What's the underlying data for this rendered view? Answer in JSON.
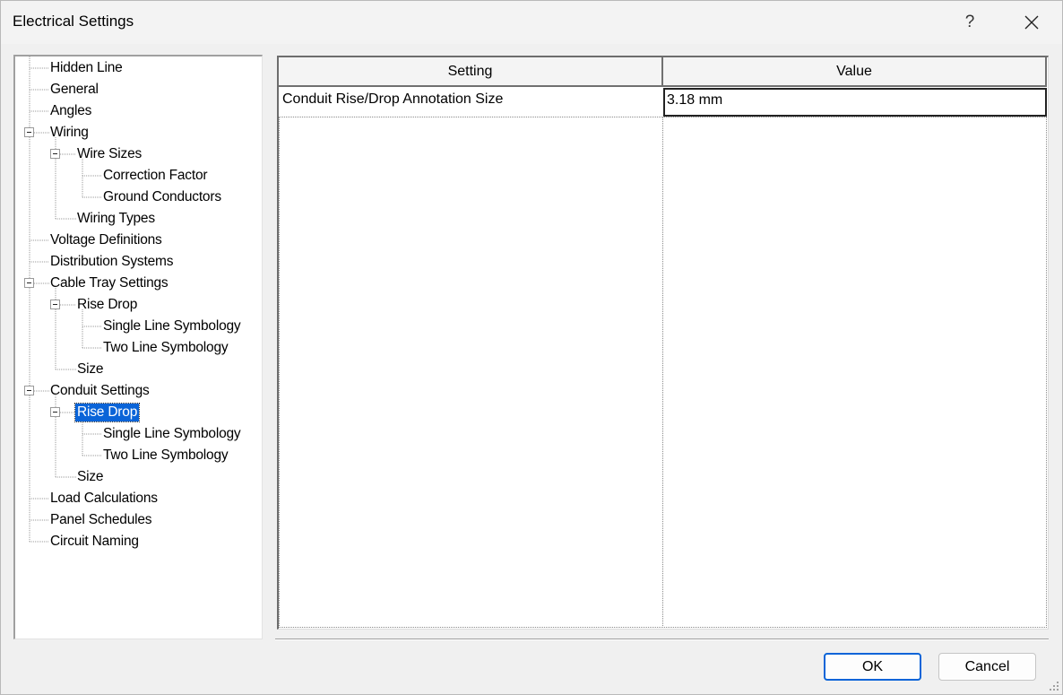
{
  "window": {
    "title": "Electrical Settings",
    "help_label": "?",
    "close_icon": "close-icon"
  },
  "tree": {
    "items": [
      {
        "label": "Hidden Line"
      },
      {
        "label": "General"
      },
      {
        "label": "Angles"
      },
      {
        "label": "Wiring"
      },
      {
        "label": "Wire Sizes"
      },
      {
        "label": "Correction Factor"
      },
      {
        "label": "Ground Conductors"
      },
      {
        "label": "Wiring Types"
      },
      {
        "label": "Voltage Definitions"
      },
      {
        "label": "Distribution Systems"
      },
      {
        "label": "Cable Tray Settings"
      },
      {
        "label": "Rise Drop"
      },
      {
        "label": "Single Line Symbology"
      },
      {
        "label": "Two Line Symbology"
      },
      {
        "label": "Size"
      },
      {
        "label": "Conduit Settings"
      },
      {
        "label": "Rise Drop"
      },
      {
        "label": "Single Line Symbology"
      },
      {
        "label": "Two Line Symbology"
      },
      {
        "label": "Size"
      },
      {
        "label": "Load Calculations"
      },
      {
        "label": "Panel Schedules"
      },
      {
        "label": "Circuit Naming"
      }
    ],
    "selected_label": "Rise Drop"
  },
  "grid": {
    "columns": [
      "Setting",
      "Value"
    ],
    "rows": [
      {
        "setting": "Conduit Rise/Drop Annotation Size",
        "value": "3.18 mm"
      }
    ]
  },
  "buttons": {
    "ok": "OK",
    "cancel": "Cancel"
  },
  "colors": {
    "selection": "#0a64d8",
    "background": "#f0f0f0"
  }
}
